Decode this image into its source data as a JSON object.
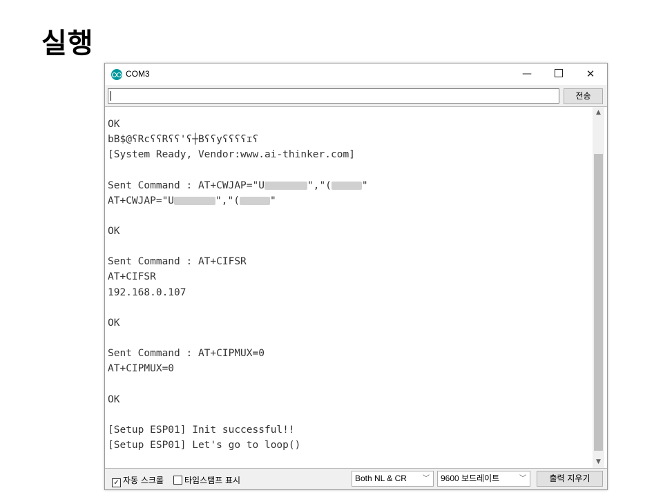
{
  "slide": {
    "title": "실행"
  },
  "window": {
    "title": "COM3",
    "minimize_glyph": "—",
    "close_glyph": "✕"
  },
  "send": {
    "input_value": "",
    "button_label": "전송"
  },
  "output": {
    "lines": [
      {
        "text": "OK"
      },
      {
        "text": "bB$@ʕRcʕʕRʕʕ'ʕ┼Bʕʕyʕʕʕʕɪʕ"
      },
      {
        "text": "[System Ready, Vendor:www.ai-thinker.com]"
      },
      {
        "text": ""
      },
      {
        "text": "Sent Command : AT+CWJAP=\"U",
        "masked": [
          {
            "width": 62,
            "after": "\",\"("
          },
          {
            "width": 44,
            "after": "\""
          }
        ]
      },
      {
        "text": "AT+CWJAP=\"U",
        "masked": [
          {
            "width": 60,
            "after": "\",\"("
          },
          {
            "width": 44,
            "after": "\""
          }
        ]
      },
      {
        "text": ""
      },
      {
        "text": "OK"
      },
      {
        "text": ""
      },
      {
        "text": "Sent Command : AT+CIFSR"
      },
      {
        "text": "AT+CIFSR"
      },
      {
        "text": "192.168.0.107"
      },
      {
        "text": ""
      },
      {
        "text": "OK"
      },
      {
        "text": ""
      },
      {
        "text": "Sent Command : AT+CIPMUX=0"
      },
      {
        "text": "AT+CIPMUX=0"
      },
      {
        "text": ""
      },
      {
        "text": "OK"
      },
      {
        "text": ""
      },
      {
        "text": "[Setup ESP01] Init successful!!"
      },
      {
        "text": "[Setup ESP01] Let's go to loop()"
      }
    ]
  },
  "status": {
    "autoscroll": {
      "label": "자동 스크롤",
      "checked": true,
      "mark": "✓"
    },
    "timestamp": {
      "label": "타임스탬프 표시",
      "checked": false
    },
    "line_ending": {
      "value": "Both NL & CR"
    },
    "baud": {
      "value": "9600 보드레이트"
    },
    "clear_label": "출력 지우기"
  },
  "icons": {
    "app": "arduino-icon",
    "dropdown": "chevron-down-icon",
    "scroll_up": "triangle-up-icon",
    "scroll_down": "triangle-down-icon"
  },
  "colors": {
    "accent": "#00979c",
    "output_text": "#333333"
  }
}
